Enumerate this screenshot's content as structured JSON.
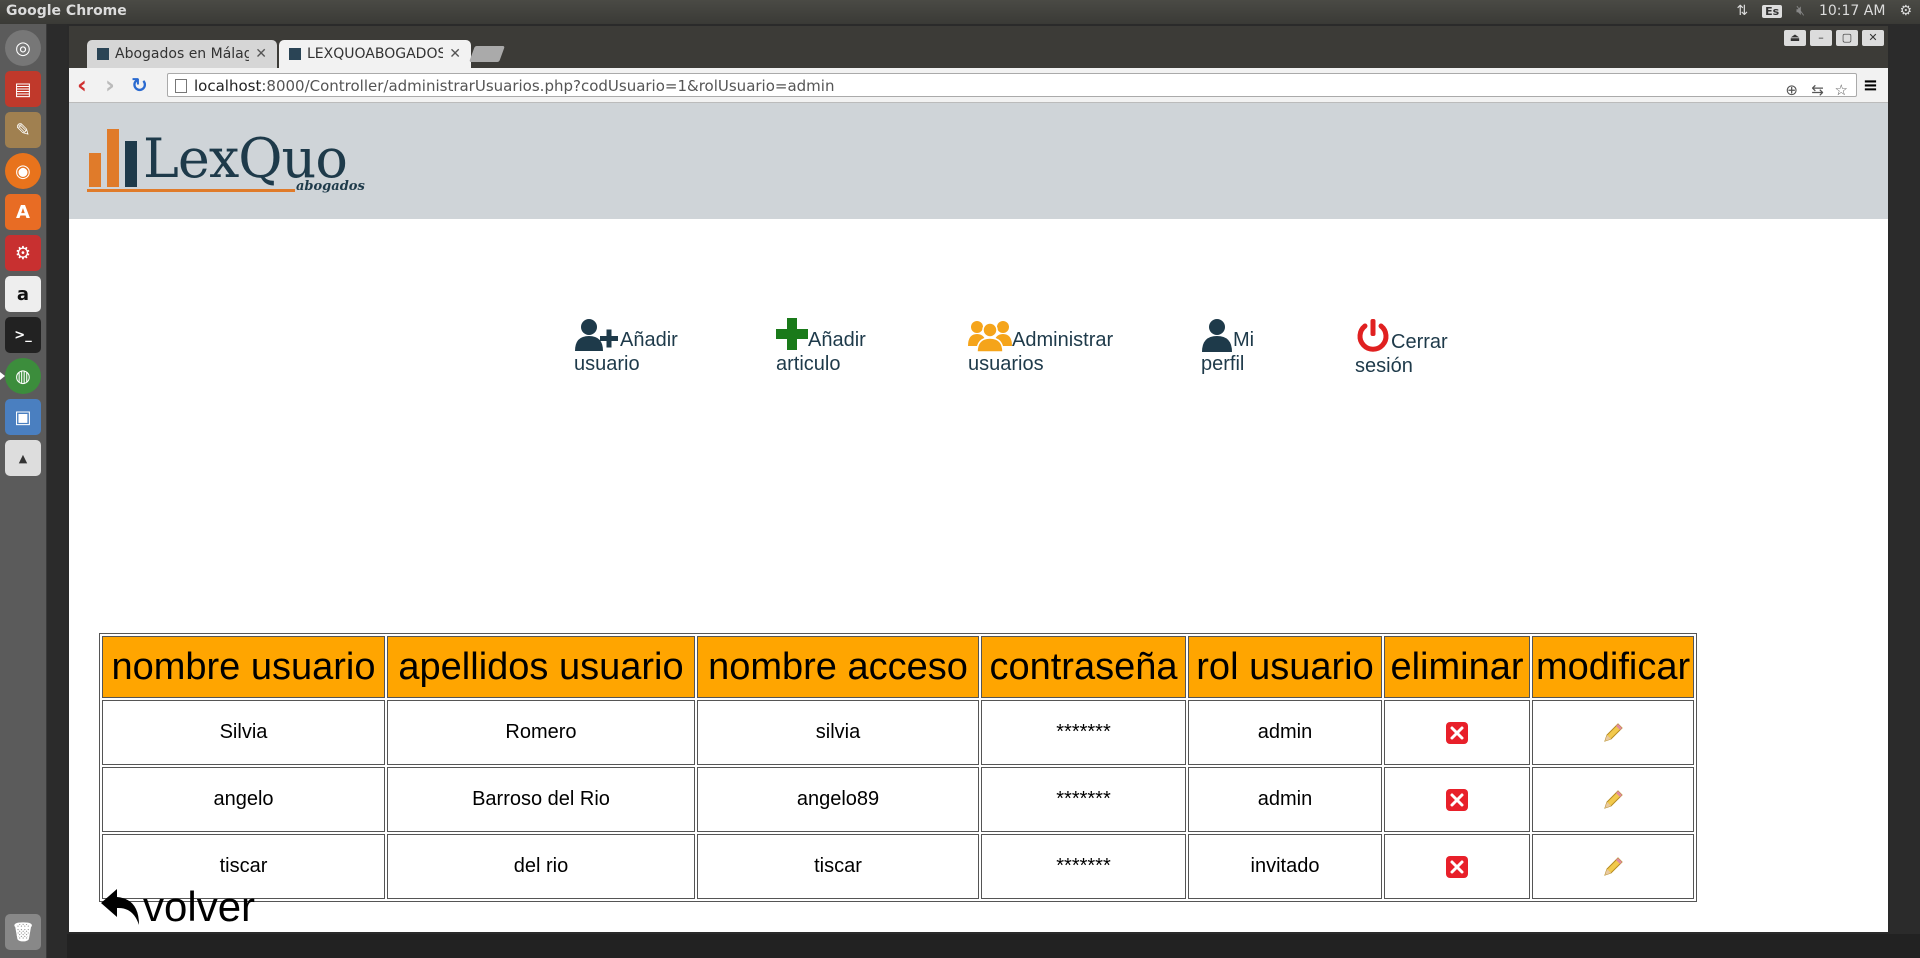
{
  "os": {
    "app_title": "Google Chrome",
    "keyboard_layout": "Es",
    "clock": "10:17 AM"
  },
  "launcher": {
    "items": [
      "dash-icon",
      "files-icon",
      "gimp-icon",
      "firefox-icon",
      "software-center-icon",
      "system-settings-icon",
      "amazon-icon",
      "terminal-icon",
      "chrome-icon",
      "virtualbox-icon",
      "photo-app-icon",
      "trash-icon"
    ]
  },
  "browser": {
    "tabs": [
      {
        "title": "Abogados en Málaga",
        "active": false
      },
      {
        "title": "LEXQUOABOGADOS",
        "active": true
      }
    ],
    "url_host": "localhost",
    "url_rest": ":8000/Controller/administrarUsuarios.php?codUsuario=1&rolUsuario=admin"
  },
  "site": {
    "logo": {
      "wordmark": "LexQuo",
      "sub": "abogados"
    },
    "menu": [
      {
        "line1": "Añadir",
        "line2": "usuario",
        "icon": "add-user-icon",
        "color": "#1e3a4a"
      },
      {
        "line1": "Añadir",
        "line2": "articulo",
        "icon": "plus-icon",
        "color": "#1a7a1a"
      },
      {
        "line1": "Administrar",
        "line2": "usuarios",
        "icon": "users-group-icon",
        "color": "#f5a41a"
      },
      {
        "line1": "Mi",
        "line2": "perfil",
        "icon": "user-icon",
        "color": "#1e3a4a"
      },
      {
        "line1": "Cerrar",
        "line2": "sesión",
        "icon": "power-icon",
        "color": "#e02020"
      }
    ],
    "table": {
      "headers": [
        "nombre usuario",
        "apellidos usuario",
        "nombre acceso",
        "contraseña",
        "rol usuario",
        "eliminar",
        "modificar"
      ],
      "rows": [
        [
          "Silvia",
          "Romero",
          "silvia",
          "*******",
          "admin"
        ],
        [
          "angelo",
          "Barroso del Rio",
          "angelo89",
          "*******",
          "admin"
        ],
        [
          "tiscar",
          "del rio",
          "tiscar",
          "*******",
          "invitado"
        ]
      ]
    },
    "back_label": "volver"
  },
  "colors": {
    "header_bg": "#cfd4d8",
    "table_header": "#ffa500",
    "brand": "#1e3a4a",
    "logo_accent": "#e07b2a"
  }
}
